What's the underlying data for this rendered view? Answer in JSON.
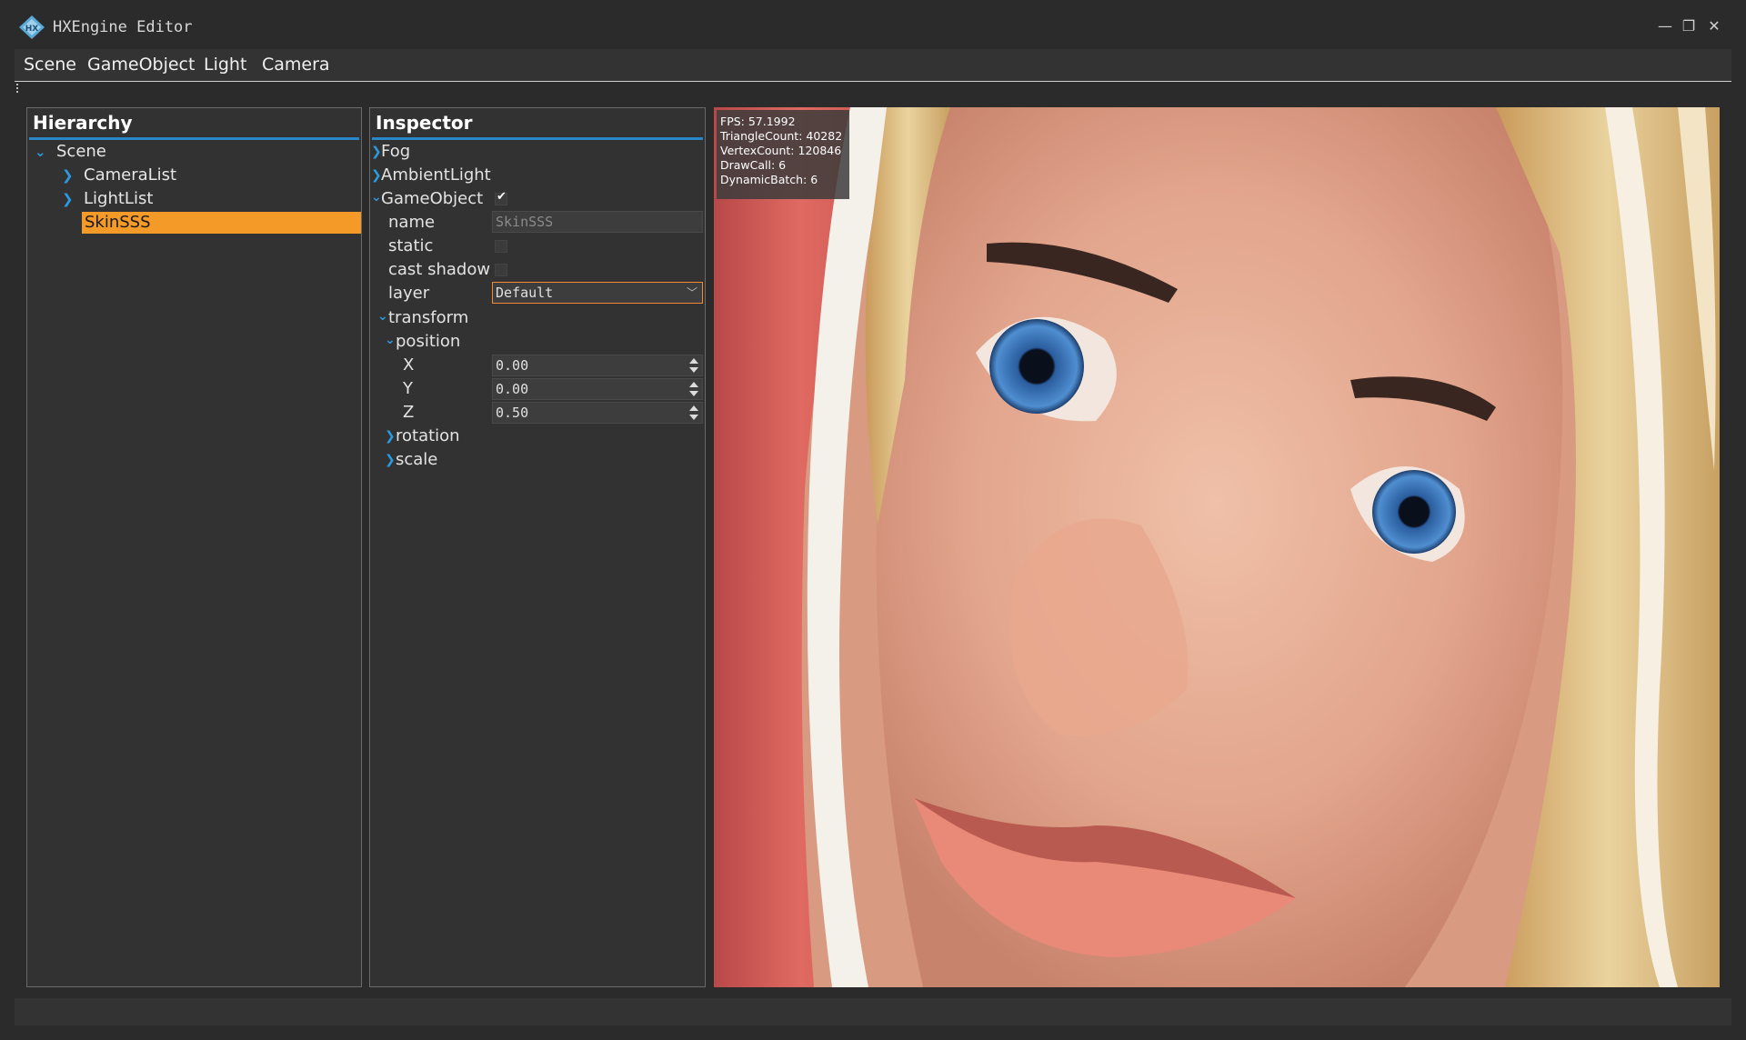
{
  "window": {
    "title": "HXEngine Editor",
    "minimize_glyph": "—",
    "maximize_glyph": "❐",
    "close_glyph": "✕"
  },
  "menu": [
    "Scene",
    "GameObject",
    "Light",
    "Camera"
  ],
  "hierarchy": {
    "title": "Hierarchy",
    "root": "Scene",
    "children": [
      "CameraList",
      "LightList"
    ],
    "selected": "SkinSSS"
  },
  "inspector": {
    "title": "Inspector",
    "sections": {
      "fog": "Fog",
      "ambient": "AmbientLight",
      "gameobject": "GameObject"
    },
    "gameobject_enabled": true,
    "fields": {
      "name_label": "name",
      "name_value": "SkinSSS",
      "static_label": "static",
      "static_checked": false,
      "cast_shadow_label": "cast shadow",
      "cast_shadow_checked": false,
      "layer_label": "layer",
      "layer_value": "Default"
    },
    "transform": {
      "label": "transform",
      "position_label": "position",
      "x_label": "X",
      "x_value": "0.00",
      "y_label": "Y",
      "y_value": "0.00",
      "z_label": "Z",
      "z_value": "0.50",
      "rotation_label": "rotation",
      "scale_label": "scale"
    }
  },
  "viewport": {
    "stats": [
      "FPS: 57.1992",
      "TriangleCount: 40282",
      "VertexCount: 120846",
      "DrawCall: 6",
      "DynamicBatch: 6"
    ]
  },
  "colors": {
    "accent": "#2a87c7",
    "selection": "#f39a28",
    "background": "#2b2b2b",
    "panel": "#323232"
  }
}
